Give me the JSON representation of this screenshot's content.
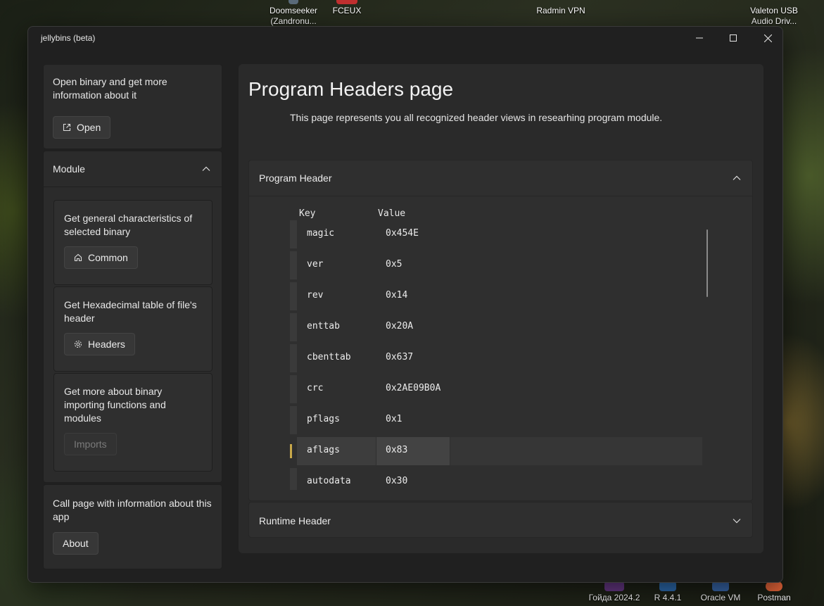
{
  "desktop": {
    "icons": [
      {
        "label": "Doomseeker (Zandronu...",
        "color": "#5a6b7a"
      },
      {
        "label": "FCEUX",
        "color": "#c03030"
      },
      {
        "label": "Radmin VPN",
        "color": "#3a7abf"
      },
      {
        "label": "Valeton USB Audio Driv...",
        "color": "#4a4a4a"
      },
      {
        "label": "Гойда 2024.2",
        "color": "#6a3a8a"
      },
      {
        "label": "R 4.4.1",
        "color": "#2f6fb5"
      },
      {
        "label": "Oracle VM",
        "color": "#3a6ab0"
      },
      {
        "label": "Postman",
        "color": "#e8663a"
      }
    ]
  },
  "window": {
    "title": "jellybins (beta)",
    "controls": {
      "minimize": "—",
      "maximize": "☐",
      "close": "✕"
    }
  },
  "sidebar": {
    "open_card": {
      "text": "Open binary and get more information about it",
      "button": "Open"
    },
    "module": {
      "label": "Module",
      "items": [
        {
          "text": "Get general characteristics of selected binary",
          "button": "Common",
          "icon": "home-icon",
          "disabled": false
        },
        {
          "text": "Get Hexadecimal table of file's header",
          "button": "Headers",
          "icon": "gear-icon",
          "disabled": false
        },
        {
          "text": "Get more about binary importing functions and modules",
          "button": "Imports",
          "icon": "",
          "disabled": true
        }
      ]
    },
    "about_card": {
      "text": "Call page with information about this app",
      "button": "About"
    }
  },
  "main": {
    "title": "Program Headers page",
    "subtitle": "This page represents you all recognized header views in researhing program module.",
    "program_header": {
      "label": "Program Header",
      "expanded": true,
      "columns": {
        "key": "Key",
        "value": "Value"
      },
      "rows": [
        {
          "key": "magic",
          "value": "0x454E"
        },
        {
          "key": "ver",
          "value": "0x5"
        },
        {
          "key": "rev",
          "value": "0x14"
        },
        {
          "key": "enttab",
          "value": "0x20A"
        },
        {
          "key": "cbenttab",
          "value": "0x637"
        },
        {
          "key": "crc",
          "value": "0x2AE09B0A"
        },
        {
          "key": "pflags",
          "value": "0x1"
        },
        {
          "key": "aflags",
          "value": "0x83"
        },
        {
          "key": "autodata",
          "value": "0x30"
        }
      ],
      "selected_row": "aflags"
    },
    "runtime_header": {
      "label": "Runtime Header",
      "expanded": false
    }
  },
  "colors": {
    "accent": "#c8a84a",
    "window_bg": "#202020",
    "card_bg": "#2b2b2b"
  }
}
